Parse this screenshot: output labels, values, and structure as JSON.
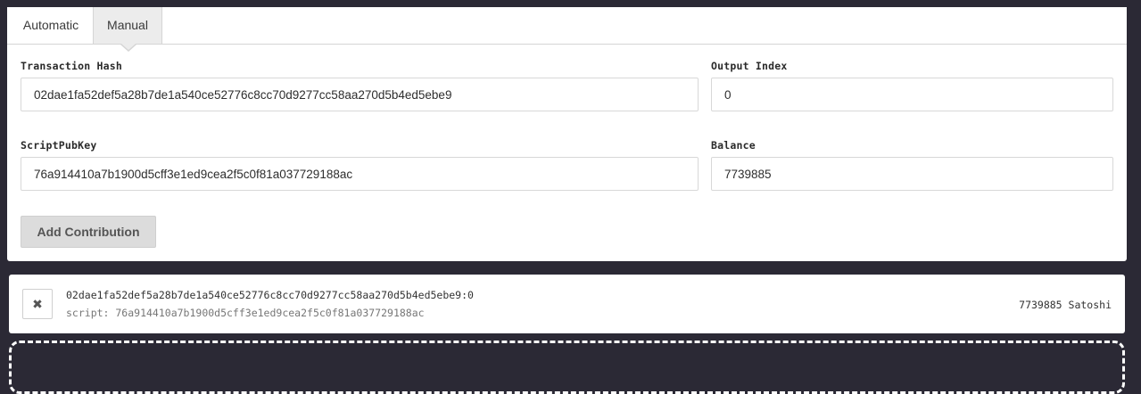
{
  "tabs": {
    "automatic": "Automatic",
    "manual": "Manual"
  },
  "form": {
    "tx_hash_label": "Transaction Hash",
    "tx_hash_value": "02dae1fa52def5a28b7de1a540ce52776c8cc70d9277cc58aa270d5b4ed5ebe9",
    "output_index_label": "Output Index",
    "output_index_value": "0",
    "script_label": "ScriptPubKey",
    "script_value": "76a914410a7b1900d5cff3e1ed9cea2f5c0f81a037729188ac",
    "balance_label": "Balance",
    "balance_value": "7739885",
    "add_button": "Add Contribution"
  },
  "contribution": {
    "remove_icon": "✖",
    "outpoint": "02dae1fa52def5a28b7de1a540ce52776c8cc70d9277cc58aa270d5b4ed5ebe9:0",
    "script": "script: 76a914410a7b1900d5cff3e1ed9cea2f5c0f81a037729188ac",
    "amount": "7739885 Satoshi"
  },
  "colors": {
    "background": "#2b2935",
    "panel": "#ffffff",
    "active_tab": "#ececec",
    "button": "#dcdcdc"
  }
}
